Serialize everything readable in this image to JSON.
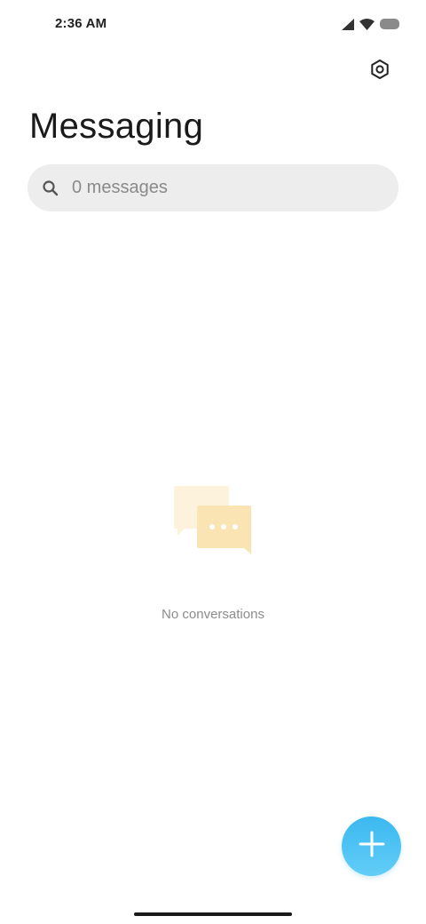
{
  "status_bar": {
    "time": "2:36 AM",
    "icons": [
      "signal-icon",
      "wifi-icon",
      "battery-icon"
    ]
  },
  "header": {
    "settings_icon": "settings-icon",
    "title": "Messaging"
  },
  "search": {
    "placeholder": "0 messages",
    "value": "",
    "icon": "search-icon"
  },
  "empty_state": {
    "illustration": "chat-bubbles-icon",
    "text": "No conversations"
  },
  "fab": {
    "icon": "plus-icon",
    "color": "#3cb8f0"
  },
  "colors": {
    "accent": "#3cb8f0",
    "search_bg": "#ededed",
    "bubble_back": "#fdf3dc",
    "bubble_front": "#fbe4b4"
  }
}
